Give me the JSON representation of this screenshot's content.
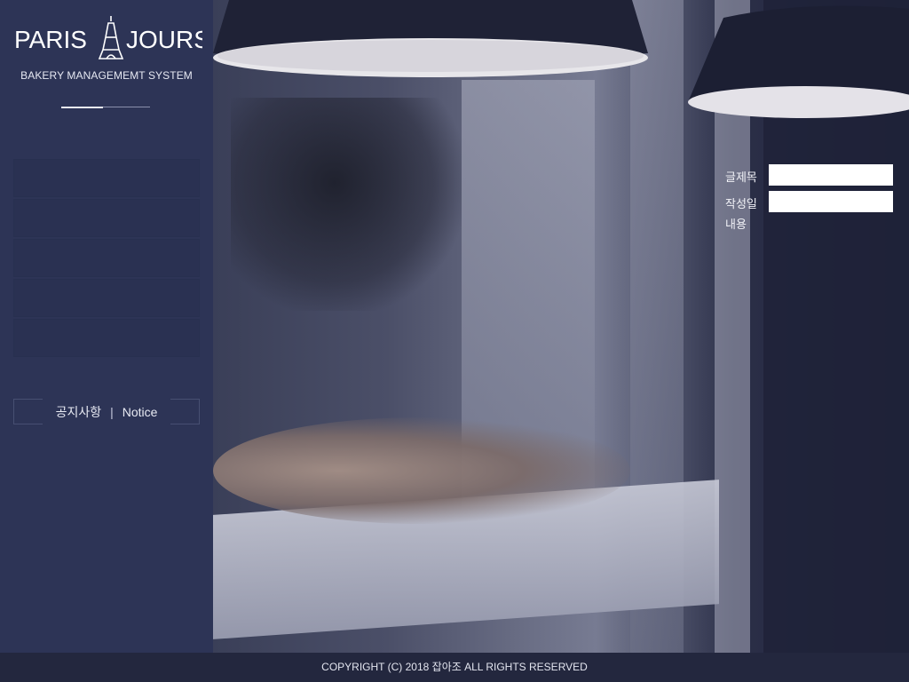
{
  "brand": {
    "name_left": "PARIS",
    "name_right": "JOURS",
    "subtitle": "BAKERY MANAGEMEMT SYSTEM"
  },
  "sidebar": {
    "menu_items": [
      "",
      "",
      "",
      "",
      ""
    ],
    "notice": {
      "label_ko": "공지사항",
      "separator": "|",
      "label_en": "Notice"
    }
  },
  "form": {
    "title_label": "글제목",
    "title_value": "",
    "date_label": "작성일",
    "date_value": "",
    "content_label": "내용"
  },
  "footer": {
    "copyright": "COPYRIGHT (C) 2018 잡아조 ALL RIGHTS RESERVED"
  },
  "colors": {
    "sidebar_bg": "#2d3456",
    "footer_bg": "#23273e",
    "text_light": "#f1f2f7"
  }
}
